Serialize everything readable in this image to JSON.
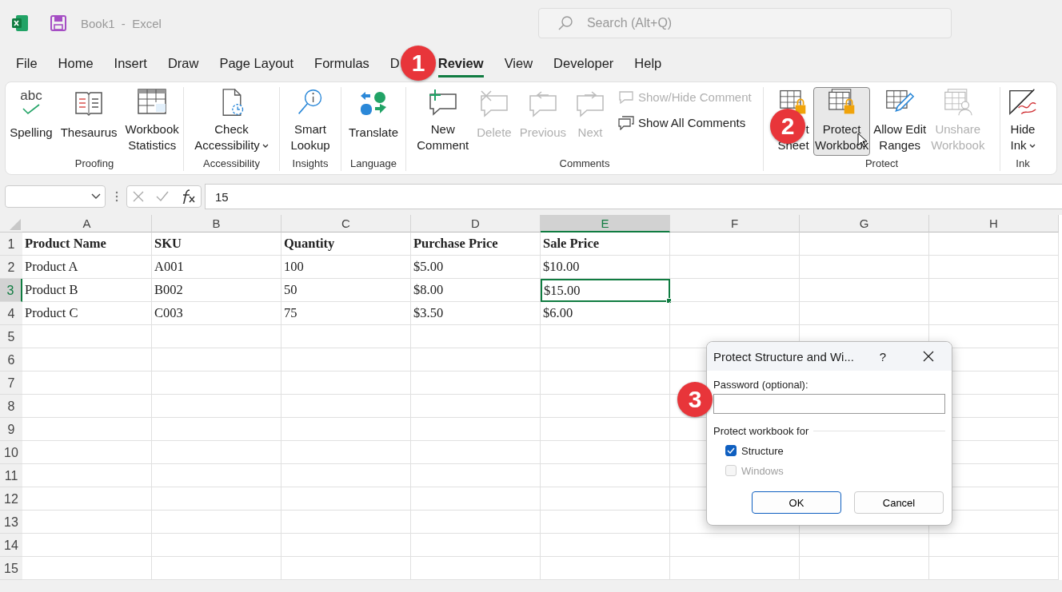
{
  "title_bar": {
    "title": "Book1  -  Excel",
    "search_placeholder": "Search (Alt+Q)"
  },
  "tabs": [
    {
      "label": "File",
      "selected": false
    },
    {
      "label": "Home",
      "selected": false
    },
    {
      "label": "Insert",
      "selected": false
    },
    {
      "label": "Draw",
      "selected": false
    },
    {
      "label": "Page Layout",
      "selected": false
    },
    {
      "label": "Formulas",
      "selected": false
    },
    {
      "label": "D",
      "selected": false
    },
    {
      "label": "Review",
      "selected": true
    },
    {
      "label": "View",
      "selected": false
    },
    {
      "label": "Developer",
      "selected": false
    },
    {
      "label": "Help",
      "selected": false
    }
  ],
  "ribbon": {
    "groups": [
      {
        "label": "Proofing",
        "buttons": [
          {
            "kind": "large",
            "icon_text": "abc",
            "lines": [
              "Spelling"
            ],
            "dropdown": false,
            "disabled": false,
            "hovered": false
          },
          {
            "kind": "large",
            "lines": [
              "Thesaurus"
            ],
            "dropdown": false,
            "disabled": false,
            "hovered": false
          },
          {
            "kind": "large",
            "lines": [
              "Workbook",
              "Statistics"
            ],
            "dropdown": false,
            "disabled": false,
            "hovered": false
          }
        ]
      },
      {
        "label": "Accessibility",
        "buttons": [
          {
            "kind": "large",
            "lines": [
              "Check",
              "Accessibility"
            ],
            "dropdown": true,
            "disabled": false,
            "hovered": false
          }
        ]
      },
      {
        "label": "Insights",
        "buttons": [
          {
            "kind": "large",
            "lines": [
              "Smart",
              "Lookup"
            ],
            "dropdown": false,
            "disabled": false,
            "hovered": false
          }
        ]
      },
      {
        "label": "Language",
        "buttons": [
          {
            "kind": "large",
            "lines": [
              "Translate"
            ],
            "dropdown": false,
            "disabled": false,
            "hovered": false
          }
        ]
      },
      {
        "label": "Comments",
        "buttons": [
          {
            "kind": "large",
            "lines": [
              "New",
              "Comment"
            ],
            "dropdown": false,
            "disabled": false,
            "hovered": false
          },
          {
            "kind": "large",
            "lines": [
              "Delete"
            ],
            "dropdown": false,
            "disabled": true,
            "hovered": false
          },
          {
            "kind": "large",
            "lines": [
              "Previous"
            ],
            "dropdown": false,
            "disabled": true,
            "hovered": false
          },
          {
            "kind": "large",
            "lines": [
              "Next"
            ],
            "dropdown": false,
            "disabled": true,
            "hovered": false
          },
          {
            "kind": "small",
            "lines": [
              "Show/Hide Comment"
            ],
            "dropdown": false,
            "disabled": true,
            "hovered": false
          },
          {
            "kind": "small",
            "lines": [
              "Show All Comments"
            ],
            "dropdown": false,
            "disabled": false,
            "hovered": false
          }
        ]
      },
      {
        "label": "Protect",
        "buttons": [
          {
            "kind": "large",
            "lines": [
              "t",
              "Sheet"
            ],
            "dropdown": false,
            "disabled": false,
            "hovered": false
          },
          {
            "kind": "large",
            "lines": [
              "Protect",
              "Workbook"
            ],
            "dropdown": false,
            "disabled": false,
            "hovered": true
          },
          {
            "kind": "large",
            "lines": [
              "Allow Edit",
              "Ranges"
            ],
            "dropdown": false,
            "disabled": false,
            "hovered": false
          },
          {
            "kind": "large",
            "lines": [
              "Unshare",
              "Workbook"
            ],
            "dropdown": false,
            "disabled": true,
            "hovered": false
          }
        ]
      },
      {
        "label": "Ink",
        "buttons": [
          {
            "kind": "large",
            "lines": [
              "Hide",
              "Ink"
            ],
            "dropdown": true,
            "disabled": false,
            "hovered": false
          }
        ]
      }
    ]
  },
  "formula_bar": {
    "value": "15"
  },
  "sheet": {
    "columns": [
      {
        "label": "A",
        "selected": false
      },
      {
        "label": "B",
        "selected": false
      },
      {
        "label": "C",
        "selected": false
      },
      {
        "label": "D",
        "selected": false
      },
      {
        "label": "E",
        "selected": true
      },
      {
        "label": "F",
        "selected": false
      },
      {
        "label": "G",
        "selected": false
      },
      {
        "label": "H",
        "selected": false
      }
    ],
    "rows": [
      {
        "number": "1",
        "selected": false,
        "bold": true,
        "cells": [
          {
            "text": "Product Name",
            "selected": false
          },
          {
            "text": "SKU",
            "selected": false
          },
          {
            "text": "Quantity",
            "selected": false
          },
          {
            "text": "Purchase Price",
            "selected": false
          },
          {
            "text": "Sale Price",
            "selected": false
          }
        ]
      },
      {
        "number": "2",
        "selected": false,
        "bold": false,
        "cells": [
          {
            "text": "Product A",
            "selected": false
          },
          {
            "text": "A001",
            "selected": false
          },
          {
            "text": "100",
            "selected": false
          },
          {
            "text": "$5.00",
            "selected": false
          },
          {
            "text": "$10.00",
            "selected": false
          }
        ]
      },
      {
        "number": "3",
        "selected": true,
        "bold": false,
        "cells": [
          {
            "text": "Product B",
            "selected": false
          },
          {
            "text": "B002",
            "selected": false
          },
          {
            "text": "50",
            "selected": false
          },
          {
            "text": "$8.00",
            "selected": false
          },
          {
            "text": "$15.00",
            "selected": true
          }
        ]
      },
      {
        "number": "4",
        "selected": false,
        "bold": false,
        "cells": [
          {
            "text": "Product C",
            "selected": false
          },
          {
            "text": "C003",
            "selected": false
          },
          {
            "text": "75",
            "selected": false
          },
          {
            "text": "$3.50",
            "selected": false
          },
          {
            "text": "$6.00",
            "selected": false
          }
        ]
      },
      {
        "number": "5",
        "selected": false
      },
      {
        "number": "6",
        "selected": false
      },
      {
        "number": "7",
        "selected": false
      },
      {
        "number": "8",
        "selected": false
      },
      {
        "number": "9",
        "selected": false
      },
      {
        "number": "10",
        "selected": false
      },
      {
        "number": "11",
        "selected": false
      },
      {
        "number": "12",
        "selected": false
      },
      {
        "number": "13",
        "selected": false
      },
      {
        "number": "14",
        "selected": false
      },
      {
        "number": "15",
        "selected": false
      }
    ]
  },
  "dialog": {
    "title": "Protect Structure and Wi...",
    "help": "?",
    "password_label": "Password (optional):",
    "section_label": "Protect workbook for",
    "options": [
      {
        "label": "Structure",
        "checked": true,
        "disabled": false
      },
      {
        "label": "Windows",
        "checked": false,
        "disabled": true
      }
    ],
    "buttons": [
      {
        "label": "OK",
        "default": true
      },
      {
        "label": "Cancel",
        "default": false
      }
    ]
  },
  "annotations": [
    {
      "number": "1"
    },
    {
      "number": "2"
    },
    {
      "number": "3"
    }
  ]
}
